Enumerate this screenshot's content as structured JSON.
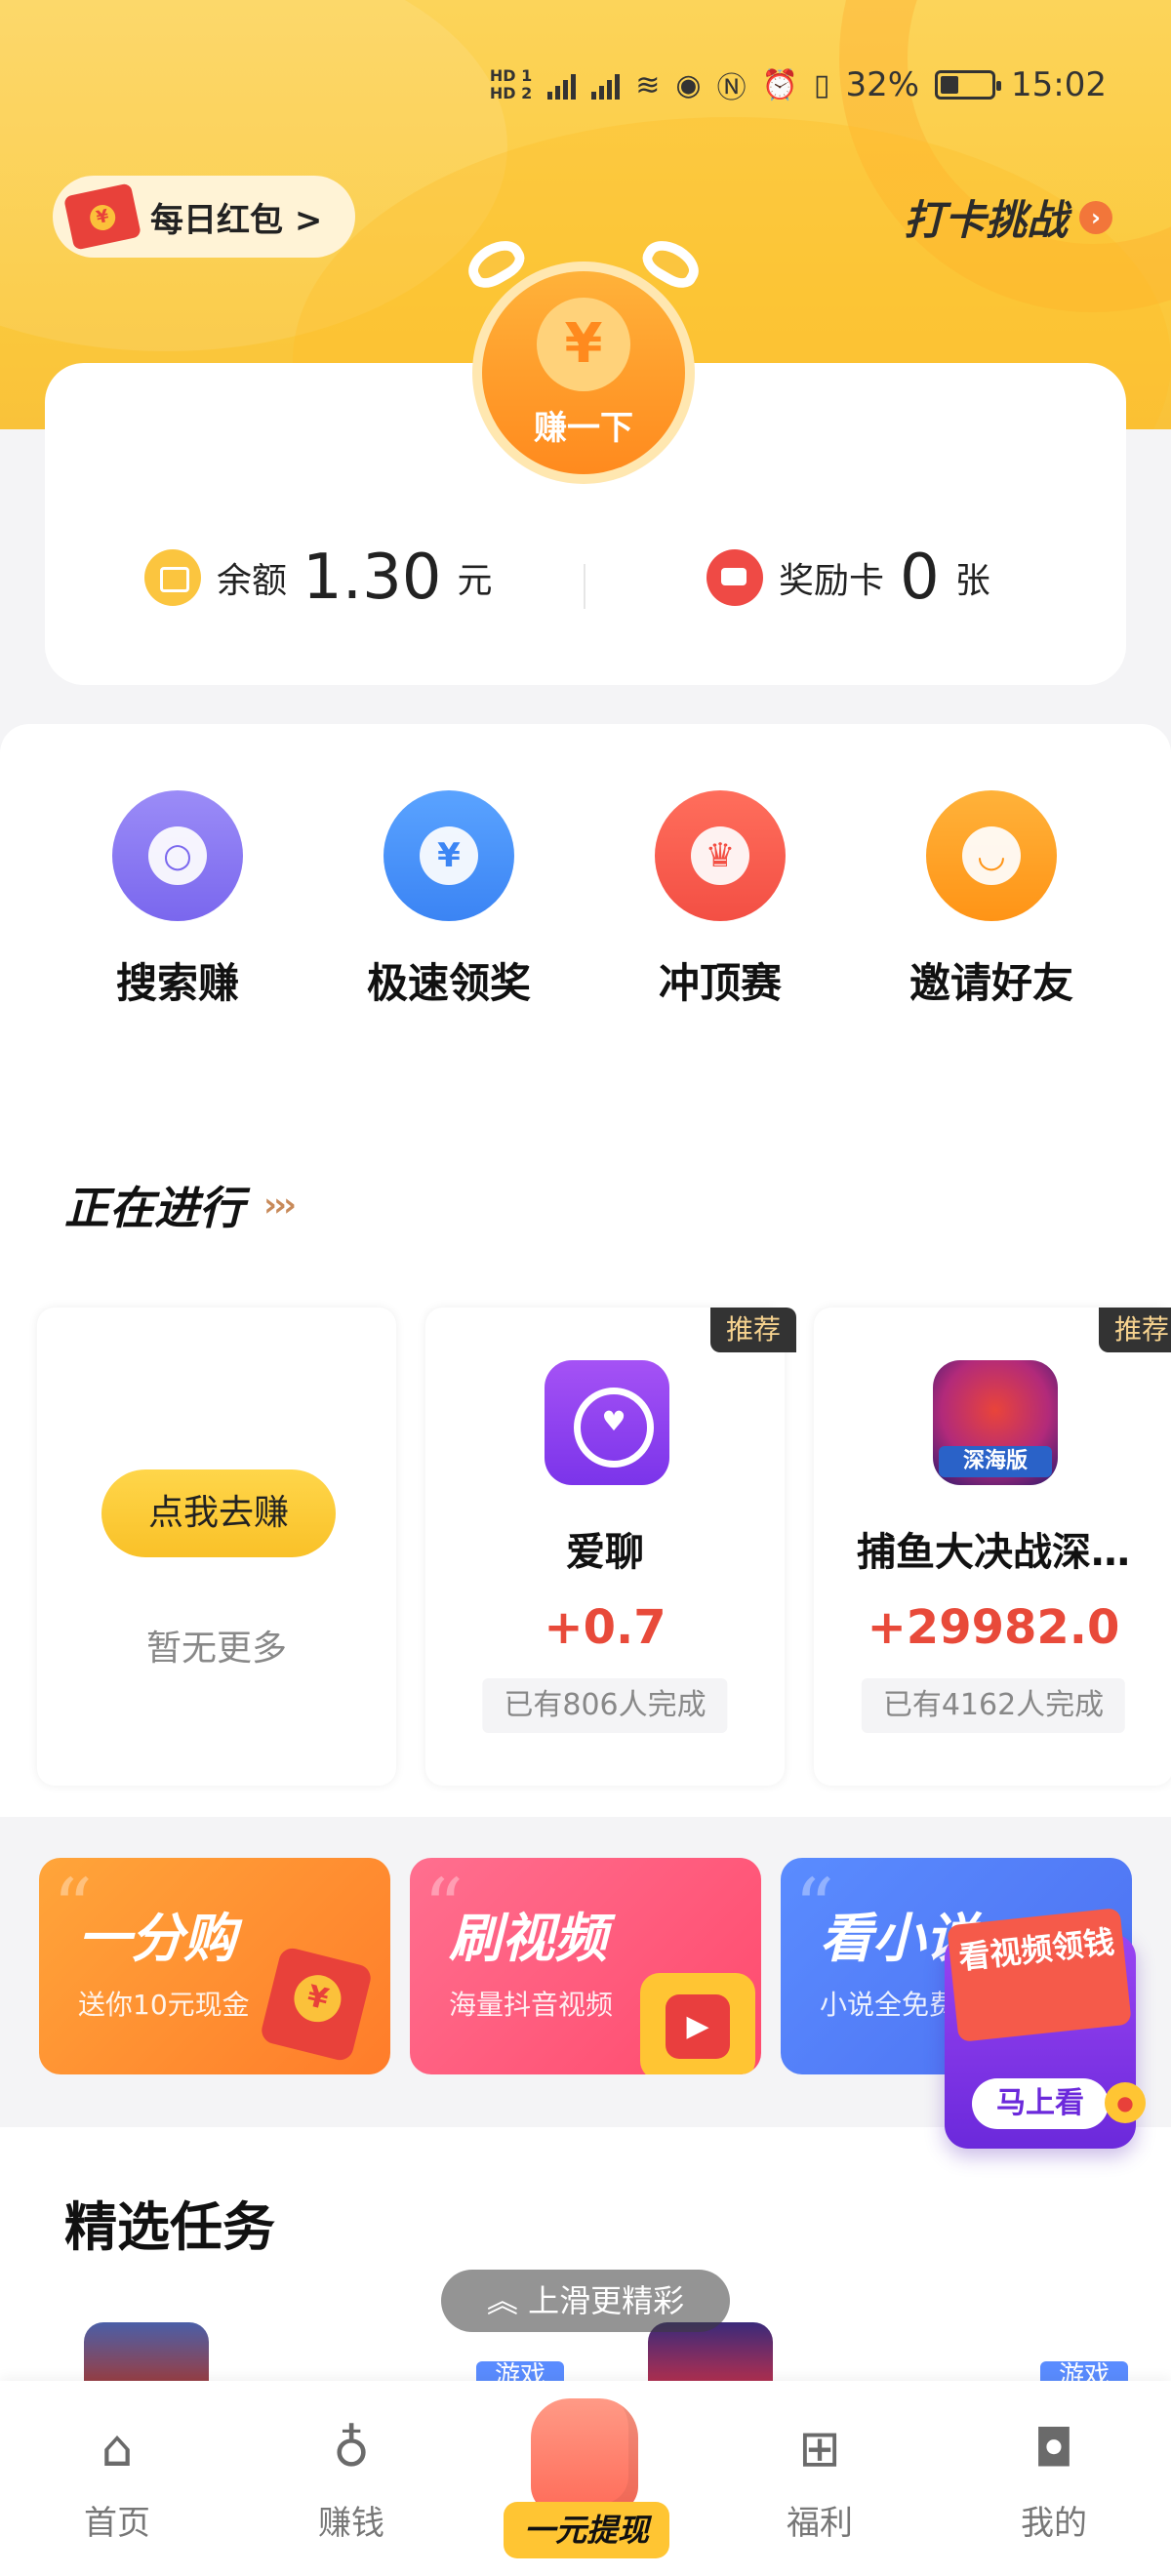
{
  "status_bar": {
    "battery": "32%",
    "time": "15:02",
    "hd_top": "HD 1",
    "hd_bottom": "HD 2",
    "net1": "4G",
    "net2": "4G"
  },
  "header": {
    "daily_redpacket": "每日红包 >",
    "challenge": "打卡挑战"
  },
  "coin_button": {
    "label": "赚一下",
    "symbol": "¥"
  },
  "balance": {
    "label": "余额",
    "value": "1.30",
    "unit": "元"
  },
  "reward_card": {
    "label": "奖励卡",
    "value": "0",
    "unit": "张"
  },
  "grid_items": [
    {
      "label": "搜索赚",
      "icon": "search-icon"
    },
    {
      "label": "极速领奖",
      "icon": "yen-icon"
    },
    {
      "label": "冲顶赛",
      "icon": "trophy-icon"
    },
    {
      "label": "邀请好友",
      "icon": "smile-icon"
    }
  ],
  "ongoing": {
    "title": "正在进行",
    "chevron": "›››",
    "empty_card": {
      "button": "点我去赚",
      "text": "暂无更多"
    },
    "cards": [
      {
        "tag": "推荐",
        "name": "爱聊",
        "reward": "+0.7",
        "done": "已有806人完成"
      },
      {
        "tag": "推荐",
        "name": "捕鱼大决战深…",
        "reward": "+29982.0",
        "done": "已有4162人完成",
        "app_badge": "深海版"
      }
    ]
  },
  "promos": [
    {
      "title": "一分购",
      "sub": "送你10元现金"
    },
    {
      "title": "刷视频",
      "sub": "海量抖音视频"
    },
    {
      "title": "看小说",
      "sub": "小说全免费"
    }
  ],
  "floating_ad": {
    "title": "看视频领钱",
    "button": "马上看"
  },
  "selected_tasks": {
    "title": "精选任务",
    "slide_hint": "上滑更精彩",
    "badge": "游戏"
  },
  "bottom_nav": [
    {
      "label": "首页",
      "icon": "home-icon"
    },
    {
      "label": "赚钱",
      "icon": "money-bag-icon"
    },
    {
      "label": "一元提现",
      "icon": "withdraw-hand-icon"
    },
    {
      "label": "福利",
      "icon": "gift-icon"
    },
    {
      "label": "我的",
      "icon": "cat-profile-icon"
    }
  ]
}
